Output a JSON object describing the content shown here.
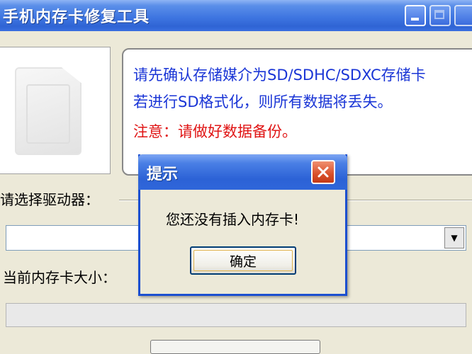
{
  "window": {
    "title": "手机内存卡修复工具"
  },
  "info": {
    "line1": "请先确认存储媒介为SD/SDHC/SDXC存储卡",
    "line2": "若进行SD格式化，则所有数据将丢失。",
    "line3": "注意：请做好数据备份。",
    "line1_color": "#1a35d6",
    "line3_color": "#e01515"
  },
  "drive": {
    "label": "请选择驱动器：",
    "selected": "",
    "arrow": "▼"
  },
  "card_size": {
    "label": "当前内存卡大小：",
    "value": ""
  },
  "dialog": {
    "title": "提示",
    "message": "您还没有插入内存卡!",
    "ok_label": "确定"
  },
  "colors": {
    "titlebar": "#3f76e1",
    "dialog_close": "#d9502a",
    "window_bg": "#ece9d8"
  }
}
